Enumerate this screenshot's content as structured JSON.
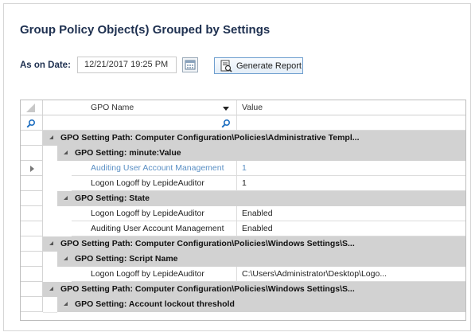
{
  "title": "Group Policy Object(s) Grouped by Settings",
  "date_filter": {
    "label": "As on Date:",
    "value": "12/21/2017 19:25 PM"
  },
  "generate_button": {
    "label": "Generate Report"
  },
  "grid": {
    "columns": {
      "gpo_name": "GPO Name",
      "value": "Value"
    },
    "rows": [
      {
        "type": "path",
        "text": "GPO Setting Path: Computer Configuration\\Policies\\Administrative Templ..."
      },
      {
        "type": "setting",
        "text": "GPO Setting: minute:Value"
      },
      {
        "type": "data",
        "name": "Auditing User Account Management",
        "value": "1",
        "selected": true
      },
      {
        "type": "data",
        "name": "Logon Logoff by LepideAuditor",
        "value": "1"
      },
      {
        "type": "setting",
        "text": "GPO Setting: State"
      },
      {
        "type": "data",
        "name": "Logon Logoff by LepideAuditor",
        "value": "Enabled"
      },
      {
        "type": "data",
        "name": "Auditing User Account Management",
        "value": "Enabled"
      },
      {
        "type": "path",
        "text": "GPO Setting Path: Computer Configuration\\Policies\\Windows Settings\\S..."
      },
      {
        "type": "setting",
        "text": "GPO Setting: Script Name"
      },
      {
        "type": "data",
        "name": "Logon Logoff by LepideAuditor",
        "value": "C:\\Users\\Administrator\\Desktop\\Logo..."
      },
      {
        "type": "path",
        "text": "GPO Setting Path: Computer Configuration\\Policies\\Windows Settings\\S..."
      },
      {
        "type": "setting",
        "text": "GPO Setting: Account lockout threshold"
      }
    ]
  },
  "colors": {
    "title": "#1e3050",
    "group_bg": "#d2d2d2",
    "selected_text": "#5a8fc4",
    "button_border": "#6f9fcf"
  }
}
